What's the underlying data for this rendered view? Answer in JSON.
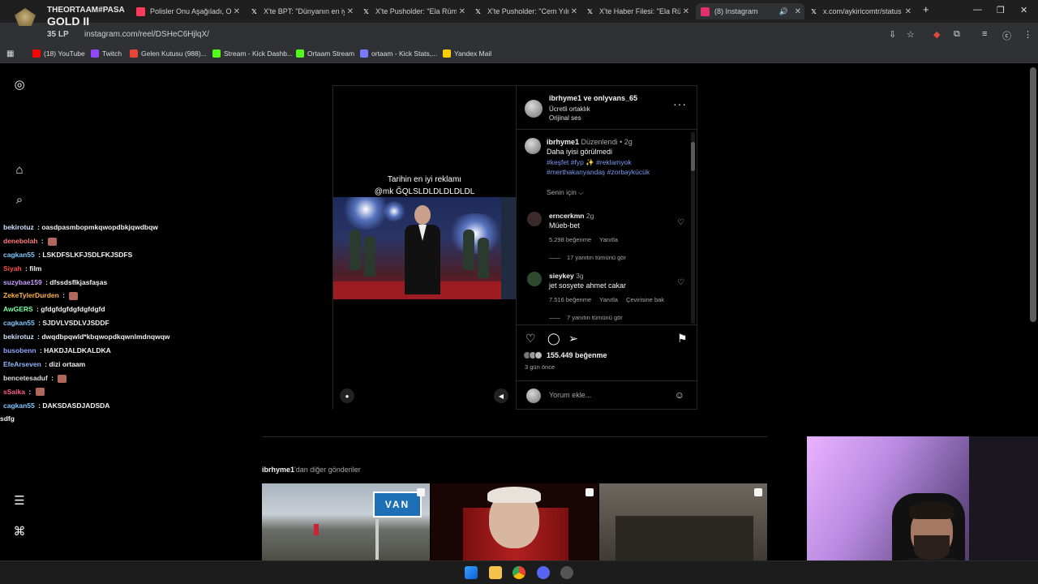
{
  "browser": {
    "tabs": [
      {
        "title": "Polisler Onu Aşağıladı, O",
        "color": "#ff3b5c"
      },
      {
        "title": "X'te BPT: \"Dünyanın en iy",
        "color": "#ffffff"
      },
      {
        "title": "X'te Pusholder: \"Ela Rüme",
        "color": "#ffffff"
      },
      {
        "title": "X'te Pusholder: \"Cem Yılm",
        "color": "#ffffff"
      },
      {
        "title": "X'te Haber Filesi: \"Ela Rü",
        "color": "#ffffff"
      },
      {
        "title": "(8) Instagram",
        "color": "#e1306c"
      },
      {
        "title": "x.com/aykiricomtr/status",
        "color": "#ffffff"
      }
    ],
    "new_tab_label": "+",
    "url": "instagram.com/reel/DSHeC6HjlqX/",
    "bookmarks": [
      {
        "label": "(18) YouTube",
        "color": "#ff0000"
      },
      {
        "label": "Twitch",
        "color": "#9146ff"
      },
      {
        "label": "Gelen Kutusu (988)...",
        "color": "#ea4335"
      },
      {
        "label": "Stream - Kick Dashb...",
        "color": "#53fc18"
      },
      {
        "label": "Ortaam Stream",
        "color": "#53fc18"
      },
      {
        "label": "ortaam - Kick Stats,...",
        "color": "#7a7aff"
      },
      {
        "label": "Yandex Mail",
        "color": "#ffcc00"
      }
    ]
  },
  "overlay": {
    "player_name": "THEORTAAM#PASA",
    "rank": "GOLD II",
    "lp": "35 LP"
  },
  "chat": [
    {
      "user": "bekirotuz",
      "text": "oasdpasmbopmkqwopdbkjqwdbqw",
      "color": "#cde3ff",
      "emote": false
    },
    {
      "user": "denebolah",
      "text": "",
      "color": "#ff7a7a",
      "emote": true
    },
    {
      "user": "cagkan55",
      "text": "LSKDFSLKFJSDLFKJSDFS",
      "color": "#7ec8ff",
      "emote": false
    },
    {
      "user": "Siyah",
      "text": "film",
      "color": "#ff4d4d",
      "emote": false
    },
    {
      "user": "suzybae159",
      "text": "dfssdsflkjasfaşas",
      "color": "#c9a0ff",
      "emote": false
    },
    {
      "user": "ZekeTylerDurden",
      "text": "",
      "color": "#ffb347",
      "emote": true
    },
    {
      "user": "AwGERS",
      "text": "gfdgfdgfdgfdgfdgfd",
      "color": "#7effa0",
      "emote": false
    },
    {
      "user": "cagkan55",
      "text": "SJDVLVSDLVJSDDF",
      "color": "#7ec8ff",
      "emote": false
    },
    {
      "user": "bekirotuz",
      "text": "dwqdbpqwld*kbqwopdkqwnlmdnqwqw",
      "color": "#cde3ff",
      "emote": false
    },
    {
      "user": "busobenn",
      "text": "HAKDJALDKALDKA",
      "color": "#8fa8ff",
      "emote": false
    },
    {
      "user": "EfeArseven",
      "text": "dizi ortaam",
      "color": "#8fb7ff",
      "emote": false
    },
    {
      "user": "bencetesaduf",
      "text": "",
      "color": "#dddddd",
      "emote": true
    },
    {
      "user": "sSaika",
      "text": "",
      "color": "#ff5c8a",
      "emote": true
    },
    {
      "user": "cagkan55",
      "text": "DAKSDASDJADSDA",
      "color": "#7ec8ff",
      "emote": false
    },
    {
      "user": "",
      "text": "sdfg",
      "color": "#dddddd",
      "emote": false
    }
  ],
  "post": {
    "video_caption_line1": "Tarihin en iyi reklamı",
    "video_caption_line2": "@mk ĞQLSLDLDLDLDLDL",
    "header_names": "ibrhyme1 ve onlyvans_65",
    "header_partner": "Ücretli ortaklık",
    "header_audio": "Orijinal ses",
    "caption_user": "ibrhyme1",
    "caption_edited": "Düzenlendi • 2g",
    "caption_text": "Daha iyisi görülmedi",
    "hashtags": "#keşfet #fyp ✨ #reklamyok #merthakanyandaş #zorbaykücük",
    "for_you": "Senin için ⌵",
    "comments": [
      {
        "user": "erncerkmn",
        "age": "2g",
        "text": "Müeb-bet",
        "likes": "5.298 beğenme",
        "reply": "Yanıtla",
        "translate": "",
        "replies": "17 yanıtın tümünü gör"
      },
      {
        "user": "sieykey",
        "age": "3g",
        "text": "jet sosyete ahmet cakar",
        "likes": "7.516 beğenme",
        "reply": "Yanıtla",
        "translate": "Çevirisine bak",
        "replies": "7 yanıtın tümünü gör"
      }
    ],
    "likes_count": "155.449 beğenme",
    "posted_ago": "3 gün önce",
    "comment_placeholder": "Yorum ekle..."
  },
  "more_posts": {
    "user": "ibrhyme1",
    "suffix": "'dan diğer gönderiler",
    "thumb_sign": "VAN"
  }
}
